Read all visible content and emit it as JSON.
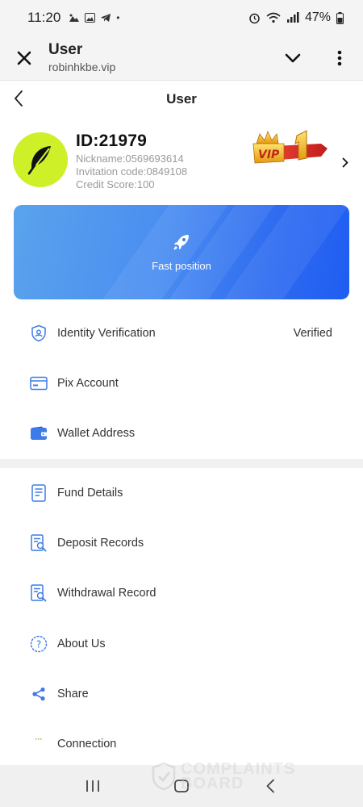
{
  "status_bar": {
    "time": "11:20",
    "battery": "47%"
  },
  "browser": {
    "title": "User",
    "url": "robinhkbe.vip"
  },
  "header": {
    "title": "User"
  },
  "user": {
    "id": "ID:21979",
    "nickname": "Nickname:0569693614",
    "invitation": "Invitation code:0849108",
    "credit": "Credit Score:100",
    "vip_level": "VIP 1"
  },
  "banner": {
    "label": "Fast position"
  },
  "menu_section_1": [
    {
      "label": "Identity Verification",
      "value": "Verified",
      "icon": "shield-user-icon"
    },
    {
      "label": "Pix Account",
      "icon": "card-icon"
    },
    {
      "label": "Wallet Address",
      "icon": "wallet-icon"
    }
  ],
  "menu_section_2": [
    {
      "label": "Fund Details",
      "icon": "document-icon"
    },
    {
      "label": "Deposit Records",
      "icon": "record-search-icon"
    },
    {
      "label": "Withdrawal Record",
      "icon": "record-search-icon"
    },
    {
      "label": "About Us",
      "icon": "help-icon"
    },
    {
      "label": "Share",
      "icon": "share-icon"
    },
    {
      "label": "Connection",
      "icon": "connection-icon"
    }
  ],
  "watermark": {
    "text": "COMPLAINTS BOARD"
  },
  "colors": {
    "accent": "#2f6cf0",
    "avatar_bg": "#cdf028",
    "icon_blue": "#3d7be8"
  }
}
